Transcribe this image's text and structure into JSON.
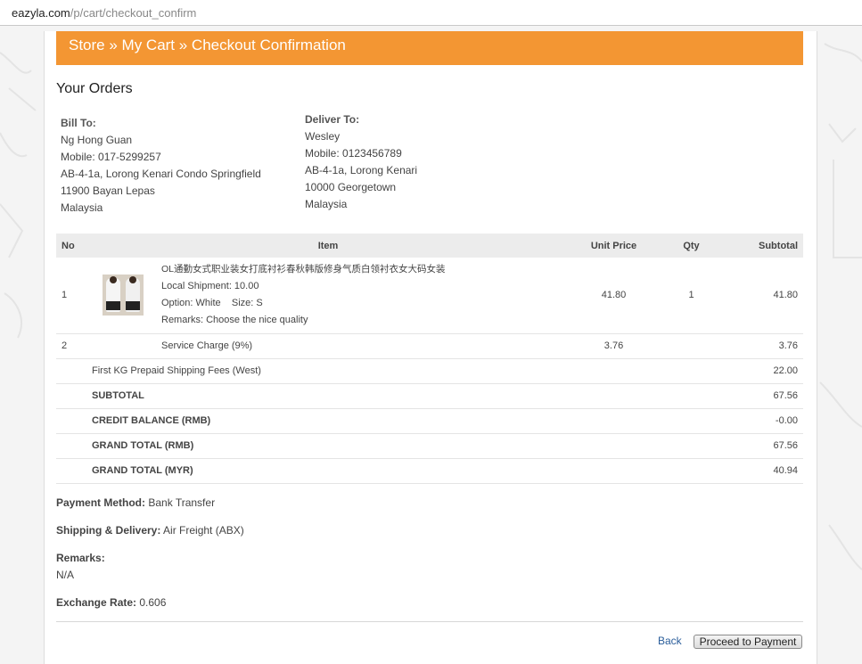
{
  "browser": {
    "url_host": "eazyla.com",
    "url_path": "/p/cart/checkout_confirm"
  },
  "banner": {
    "title": "Store » My Cart » Checkout Confirmation"
  },
  "section_title": "Your Orders",
  "bill_to": {
    "heading": "Bill To:",
    "lines": [
      "Ng Hong Guan",
      "Mobile: 017-5299257",
      "AB-4-1a, Lorong Kenari Condo Springfield",
      "11900 Bayan Lepas",
      "Malaysia"
    ]
  },
  "deliver_to": {
    "heading": "Deliver To:",
    "lines": [
      "Wesley",
      "Mobile: 0123456789",
      "AB-4-1a, Lorong Kenari",
      "10000 Georgetown",
      "Malaysia"
    ]
  },
  "table": {
    "headers": {
      "no": "No",
      "item": "Item",
      "unit_price": "Unit Price",
      "qty": "Qty",
      "subtotal": "Subtotal"
    },
    "product": {
      "no": "1",
      "title": "OL通勤女式职业装女打底衬衫春秋韩版修身气质白领衬衣女大码女装",
      "shipment": "Local Shipment: 10.00",
      "option": "Option: White    Size: S",
      "remarks": "Remarks: Choose the nice quality",
      "unit_price": "41.80",
      "qty": "1",
      "subtotal": "41.80"
    },
    "service": {
      "no": "2",
      "label": "Service Charge (9%)",
      "unit_price": "3.76",
      "subtotal": "3.76"
    },
    "summary": [
      {
        "label": "First KG Prepaid Shipping Fees (West)",
        "value": "22.00",
        "bold": false
      },
      {
        "label": "SUBTOTAL",
        "value": "67.56",
        "bold": true
      },
      {
        "label": "CREDIT BALANCE (RMB)",
        "value": "-0.00",
        "bold": true
      },
      {
        "label": "GRAND TOTAL (RMB)",
        "value": "67.56",
        "bold": true
      },
      {
        "label": "GRAND TOTAL (MYR)",
        "value": "40.94",
        "bold": true
      }
    ]
  },
  "payment": {
    "label": "Payment Method:",
    "value": "Bank Transfer"
  },
  "shipping": {
    "label": "Shipping & Delivery:",
    "value": "Air Freight (ABX)"
  },
  "remarks": {
    "label": "Remarks:",
    "value": "N/A"
  },
  "exchange": {
    "label": "Exchange Rate:",
    "value": "0.606"
  },
  "actions": {
    "back": "Back",
    "proceed": "Proceed to Payment"
  },
  "colors": {
    "banner": "#f39633",
    "link": "#2a5d9a"
  }
}
